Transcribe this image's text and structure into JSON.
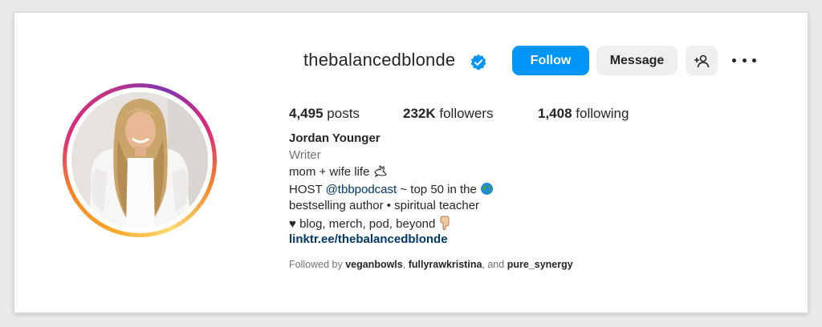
{
  "profile": {
    "username": "thebalancedblonde",
    "verified": true,
    "buttons": {
      "follow": "Follow",
      "message": "Message",
      "add_user_icon": "person-add-icon",
      "more_icon": "ellipsis-icon"
    },
    "stats": {
      "posts_count": "4,495",
      "posts_label": "posts",
      "followers_count": "232K",
      "followers_label": "followers",
      "following_count": "1,408",
      "following_label": "following"
    },
    "bio": {
      "name": "Jordan Younger",
      "category": "Writer",
      "line1": "mom + wife life",
      "line2_prefix": "HOST",
      "line2_mention": "@tbbpodcast",
      "line2_suffix": "~ top 50 in the",
      "line3": "bestselling author • spiritual teacher",
      "line4": "♥ blog, merch, pod, beyond",
      "link": "linktr.ee/thebalancedblonde"
    },
    "followed_by": {
      "prefix": "Followed by",
      "user1": "veganbowls",
      "sep": ",",
      "user2": "fullyrawkristina",
      "and": ", and",
      "user3": "pure_synergy"
    }
  },
  "colors": {
    "follow_button": "#0095f6",
    "secondary_button": "#efefef",
    "link": "#00376b",
    "verified_badge": "#0095f6"
  }
}
